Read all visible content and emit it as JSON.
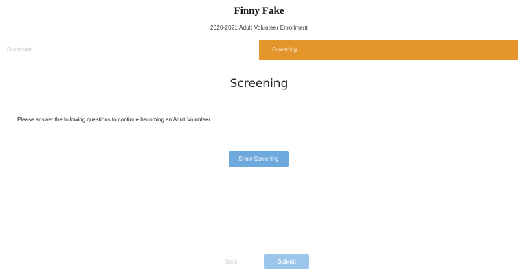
{
  "header": {
    "title": "Finny Fake",
    "subtitle": "2020-2021 Adult Volunteer Enrollment"
  },
  "steps": {
    "previous_label": "Registration",
    "current_label": "Screening",
    "active_color": "#e3952b"
  },
  "main": {
    "heading": "Screening",
    "instructions": "Please answer the following questions to continue becoming an Adult Volunteer.",
    "show_screening_label": "Show Screening"
  },
  "footer": {
    "back_label": "Back",
    "submit_label": "Submit"
  }
}
